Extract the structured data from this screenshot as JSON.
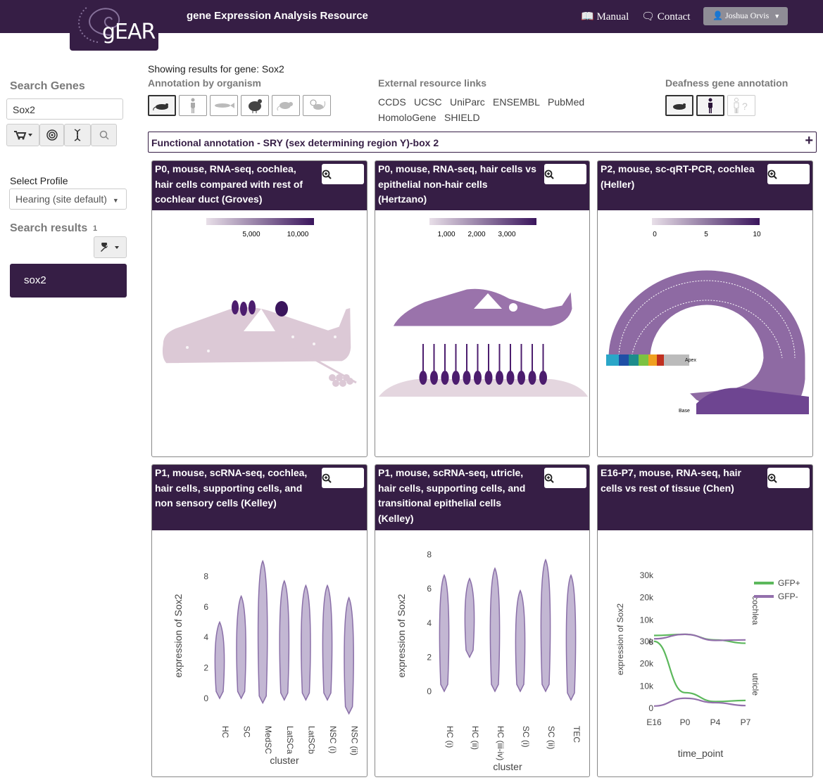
{
  "nav": {
    "logo_text": "gEAR",
    "title": "gene Expression Analysis Resource",
    "manual": "Manual",
    "contact": "Contact",
    "user": "Joshua Orvis"
  },
  "sidebar": {
    "search_label": "Search Genes",
    "search_value": "Sox2",
    "profile_label": "Select Profile",
    "profile_value": "Hearing (site default)",
    "results_label": "Search results",
    "results_count": "1",
    "result_item": "sox2"
  },
  "header": {
    "showing": "Showing results for gene: Sox2",
    "annotation_by_org": "Annotation by organism",
    "external_links_label": "External resource links",
    "external_links": [
      "CCDS",
      "UCSC",
      "UniParc",
      "ENSEMBL",
      "PubMed",
      "HomoloGene",
      "SHIELD"
    ],
    "deafness_label": "Deafness gene annotation",
    "functional": "Functional annotation - SRY (sex determining region Y)-box 2"
  },
  "cards": [
    {
      "title": "P0, mouse, RNA-seq, cochlea, hair cells compared with rest of cochlear duct (Groves)",
      "scale_ticks": [
        "5,000",
        "10,000"
      ]
    },
    {
      "title": "P0, mouse, RNA-seq, hair cells vs epithelial non-hair cells (Hertzano)",
      "scale_ticks": [
        "1,000",
        "2,000",
        "3,000"
      ]
    },
    {
      "title": "P2, mouse, sc-qRT-PCR, cochlea (Heller)",
      "scale_ticks": [
        "0",
        "5",
        "10"
      ],
      "labels": [
        "Apex",
        "Base"
      ]
    },
    {
      "title": "P1, mouse, scRNA-seq, cochlea, hair cells, supporting cells, and non sensory cells (Kelley)"
    },
    {
      "title": "P1, mouse, scRNA-seq, utricle, hair cells, supporting cells, and transitional epithelial cells (Kelley)"
    },
    {
      "title": "E16-P7, mouse, RNA-seq, hair cells vs rest of tissue (Chen)"
    }
  ],
  "colors": {
    "brand": "#361e45",
    "violin": "#c3b7d3",
    "violin_edge": "#8a6fa8",
    "gfp_plus": "#5cb85c",
    "gfp_minus": "#9370ac"
  },
  "chart_data": [
    {
      "type": "violin",
      "xlabel": "cluster",
      "ylabel": "expression of Sox2",
      "yticks": [
        0,
        2,
        4,
        6,
        8
      ],
      "categories": [
        "HC",
        "SC",
        "MedSC",
        "LatSCa",
        "LatSCb",
        "NSC (i)",
        "NSC (ii)"
      ],
      "ranges": [
        [
          0,
          5
        ],
        [
          0,
          6.7
        ],
        [
          -0.3,
          9
        ],
        [
          -0.1,
          7.7
        ],
        [
          -0.1,
          7.4
        ],
        [
          -0.1,
          7.4
        ],
        [
          -1,
          6.6
        ]
      ]
    },
    {
      "type": "violin",
      "xlabel": "cluster",
      "ylabel": "expression of Sox2",
      "yticks": [
        0,
        2,
        4,
        6,
        8
      ],
      "categories": [
        "HC (i)",
        "HC (ii)",
        "HC (iii-iv)",
        "SC (i)",
        "SC (ii)",
        "TEC"
      ],
      "ranges": [
        [
          0,
          6.8
        ],
        [
          2,
          6.6
        ],
        [
          0,
          7.2
        ],
        [
          0,
          5.9
        ],
        [
          0,
          7.7
        ],
        [
          -0.5,
          6.8
        ]
      ]
    },
    {
      "type": "line",
      "xlabel": "time_point",
      "ylabel": "expression of Sox2",
      "x": [
        "E16",
        "P0",
        "P4",
        "P7"
      ],
      "facets": [
        {
          "name": "cochlea",
          "series": [
            {
              "name": "GFP+",
              "values": [
                3000,
                3500,
                1000,
                -500
              ]
            },
            {
              "name": "GFP-",
              "values": [
                1500,
                3500,
                800,
                1000
              ]
            }
          ]
        },
        {
          "name": "utricle",
          "series": [
            {
              "name": "GFP+",
              "values": [
                30000,
                7000,
                3000,
                3500
              ]
            },
            {
              "name": "GFP-",
              "values": [
                1000,
                4500,
                2500,
                1200
              ]
            }
          ]
        }
      ],
      "yticks": [
        "0",
        "10k",
        "20k",
        "30k"
      ],
      "legend": [
        "GFP+",
        "GFP-"
      ]
    }
  ]
}
